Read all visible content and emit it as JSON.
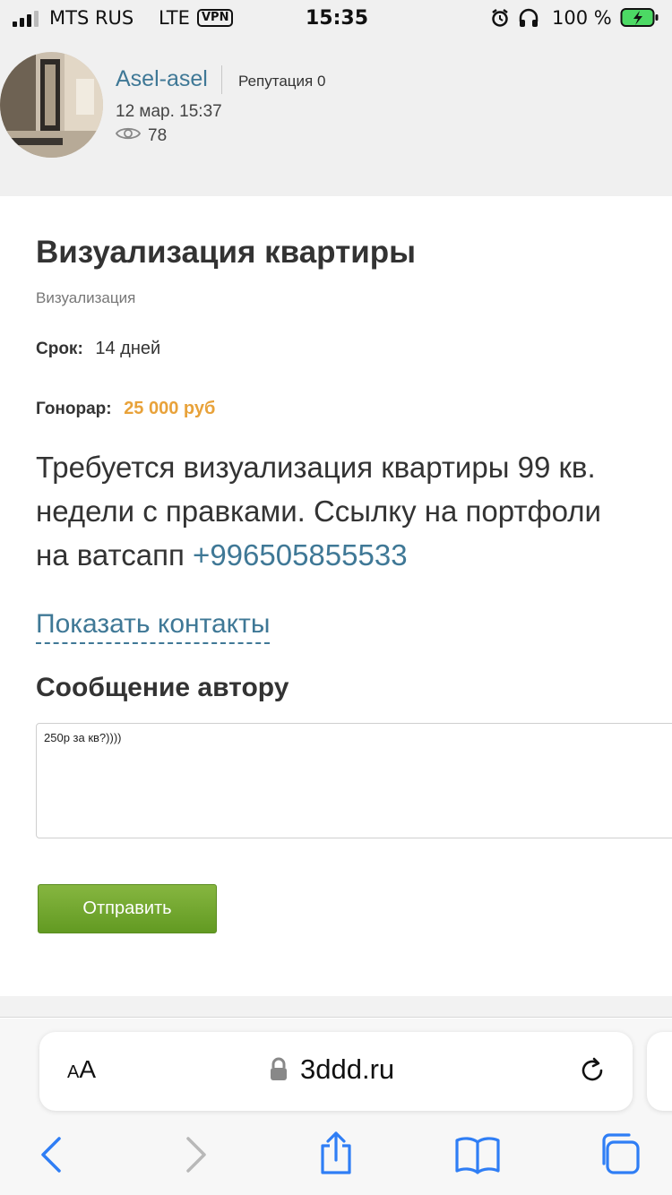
{
  "status_bar": {
    "carrier": "MTS RUS",
    "network": "LTE",
    "vpn": "VPN",
    "time": "15:35",
    "battery": "100 %"
  },
  "author": {
    "name": "Asel-asel",
    "reputation": "Репутация 0",
    "date": "12 мар. 15:37",
    "views": "78"
  },
  "job": {
    "title": "Визуализация квартиры",
    "category": "Визуализация",
    "deadline_label": "Срок:",
    "deadline_value": "14 дней",
    "fee_label": "Гонорар:",
    "fee_value": "25 000 руб",
    "description_line1": "Требуется визуализация квартиры 99 кв.",
    "description_line2": "недели с правками. Ссылку на портфоли",
    "description_line3_prefix": "на ватсапп ",
    "description_phone": "+996505855533",
    "show_contacts": "Показать контакты"
  },
  "message": {
    "heading": "Сообщение автору",
    "text": "250р за кв?))))",
    "send_label": "Отправить"
  },
  "browser": {
    "aa_label_small": "A",
    "aa_label_large": "A",
    "url": "3ddd.ru"
  },
  "colors": {
    "link": "#3f7896",
    "fee": "#e8a23a",
    "send_button": "#74a930",
    "header_bg": "#f0f0f0"
  }
}
